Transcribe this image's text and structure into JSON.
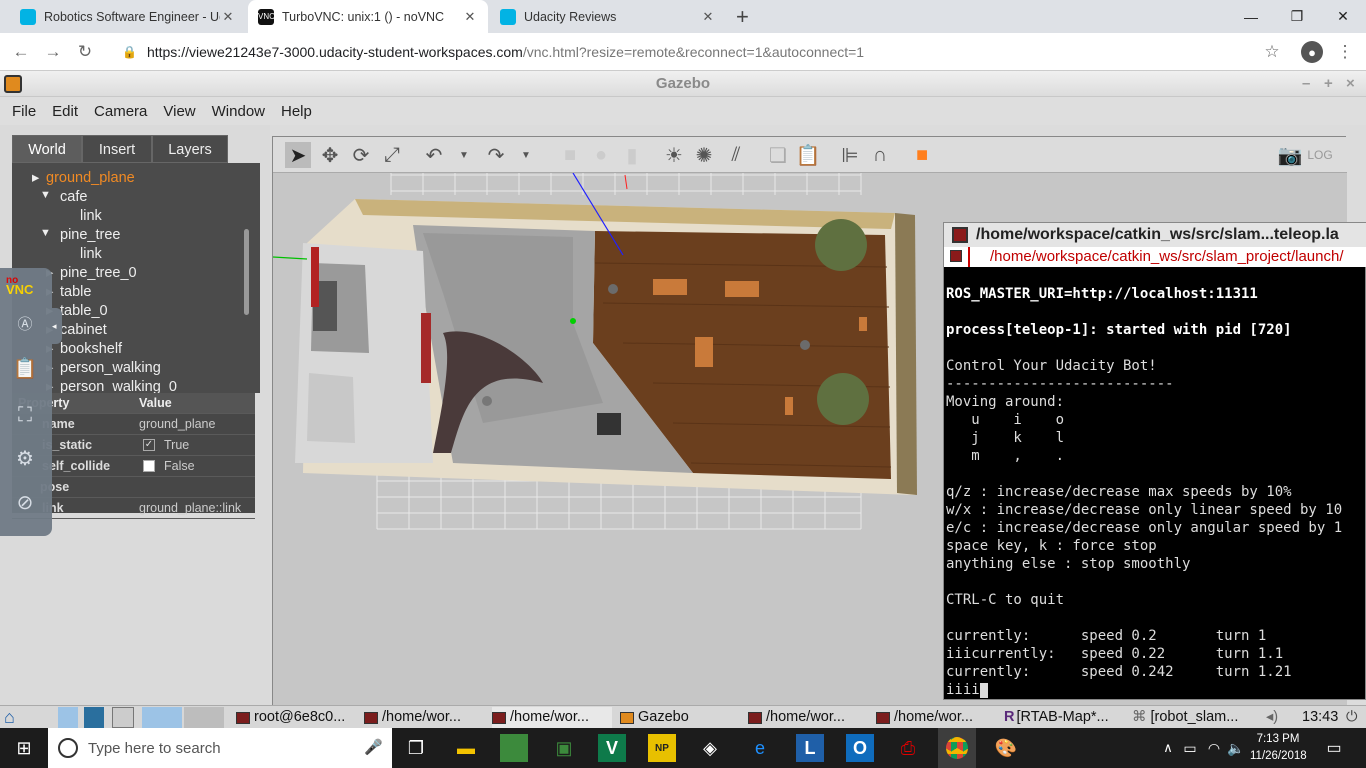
{
  "browser": {
    "tabs": [
      {
        "label": "Robotics Software Engineer - Uda",
        "icon": "udacity-icon",
        "active": false
      },
      {
        "label": "TurboVNC: unix:1 () - noVNC",
        "icon": "vnc-icon",
        "active": true
      },
      {
        "label": "Udacity Reviews",
        "icon": "udacity-icon",
        "active": false
      }
    ],
    "new_tab": "+",
    "url_host": "https://viewe21243e7-3000.udacity-student-workspaces.com",
    "url_path": "/vnc.html?resize=remote&reconnect=1&autoconnect=1"
  },
  "gazebo": {
    "title": "Gazebo",
    "menu": [
      "File",
      "Edit",
      "Camera",
      "View",
      "Window",
      "Help"
    ],
    "left_tabs": [
      "World",
      "Insert",
      "Layers"
    ],
    "tree": [
      "ground_plane",
      "cafe",
      "link",
      "pine_tree",
      "link",
      "pine_tree_0",
      "table",
      "table_0",
      "cabinet",
      "bookshelf",
      "person_walking",
      "person_walking_0"
    ],
    "props_header": {
      "property": "Property",
      "value": "Value"
    },
    "props": [
      {
        "k": "name",
        "v": "ground_plane"
      },
      {
        "k": "is_static",
        "v": "True"
      },
      {
        "k": "self_collide",
        "v": "False"
      },
      {
        "k": "pose",
        "v": ""
      },
      {
        "k": "link",
        "v": "ground_plane::link"
      }
    ]
  },
  "novnc": {
    "logo_top": "no",
    "logo_bottom": "VNC"
  },
  "terminal": {
    "title": "/home/workspace/catkin_ws/src/slam...teleop.la",
    "subtitle": "/home/workspace/catkin_ws/src/slam_project/launch/",
    "lines": [
      "ROS_MASTER_URI=http://localhost:11311",
      "",
      "process[teleop-1]: started with pid [720]",
      "",
      "Control Your Udacity Bot!",
      "---------------------------",
      "Moving around:",
      "   u    i    o",
      "   j    k    l",
      "   m    ,    .",
      "",
      "q/z : increase/decrease max speeds by 10%",
      "w/x : increase/decrease only linear speed by 10",
      "e/c : increase/decrease only angular speed by 1",
      "space key, k : force stop",
      "anything else : stop smoothly",
      "",
      "CTRL-C to quit",
      "",
      "currently:      speed 0.2       turn 1",
      "iiicurrently:   speed 0.22      turn 1.1",
      "currently:      speed 0.242     turn 1.21",
      "iiii"
    ]
  },
  "vnc_taskbar": {
    "items": [
      "root@6e8c0...",
      "/home/wor...",
      "/home/wor...",
      "Gazebo",
      "/home/wor...",
      "/home/wor...",
      "[RTAB-Map*...",
      "[robot_slam..."
    ],
    "time": "13:43"
  },
  "windows_taskbar": {
    "search_placeholder": "Type here to search",
    "time": "7:13 PM",
    "date": "11/26/2018"
  }
}
